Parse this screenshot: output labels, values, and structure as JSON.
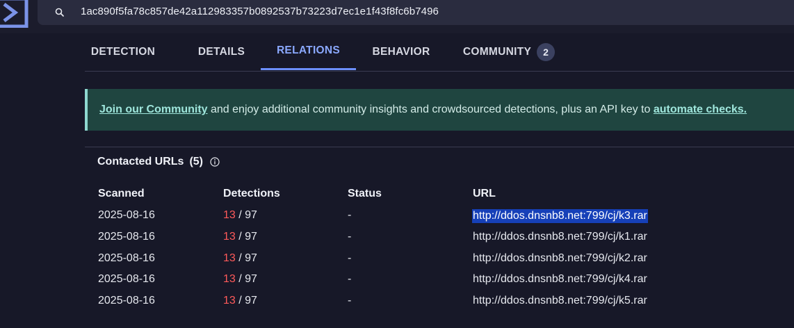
{
  "search": {
    "value": "1ac890f5fa78c857de42a112983357b0892537b73223d7ec1e1f43f8fc6b7496"
  },
  "tabs": [
    {
      "label": "DETECTION"
    },
    {
      "label": "DETAILS"
    },
    {
      "label": "RELATIONS",
      "active": true
    },
    {
      "label": "BEHAVIOR"
    },
    {
      "label": "COMMUNITY",
      "badge": "2"
    }
  ],
  "banner": {
    "link1": "Join our Community",
    "text": " and enjoy additional community insights and crowdsourced detections, plus an API key to ",
    "link2": "automate checks."
  },
  "contacted_urls": {
    "title": "Contacted URLs",
    "count": "(5)",
    "columns": [
      "Scanned",
      "Detections",
      "Status",
      "URL"
    ],
    "rows": [
      {
        "scanned": "2025-08-16",
        "detections": "13",
        "total": "/ 97",
        "status": "-",
        "url": "http://ddos.dnsnb8.net:799/cj/k3.rar"
      },
      {
        "scanned": "2025-08-16",
        "detections": "13",
        "total": "/ 97",
        "status": "-",
        "url": "http://ddos.dnsnb8.net:799/cj/k1.rar"
      },
      {
        "scanned": "2025-08-16",
        "detections": "13",
        "total": "/ 97",
        "status": "-",
        "url": "http://ddos.dnsnb8.net:799/cj/k2.rar"
      },
      {
        "scanned": "2025-08-16",
        "detections": "13",
        "total": "/ 97",
        "status": "-",
        "url": "http://ddos.dnsnb8.net:799/cj/k4.rar"
      },
      {
        "scanned": "2025-08-16",
        "detections": "13",
        "total": "/ 97",
        "status": "-",
        "url": "http://ddos.dnsnb8.net:799/cj/k5.rar"
      }
    ]
  },
  "colors": {
    "background": "#171828",
    "accent": "#8ba9ff",
    "detection_positive": "#ff5a5a",
    "banner_bg": "#1f4540",
    "selection": "#1640b8"
  },
  "icons": {
    "logo": "virustotal-logo-icon",
    "search": "search-icon",
    "info": "info-icon"
  }
}
